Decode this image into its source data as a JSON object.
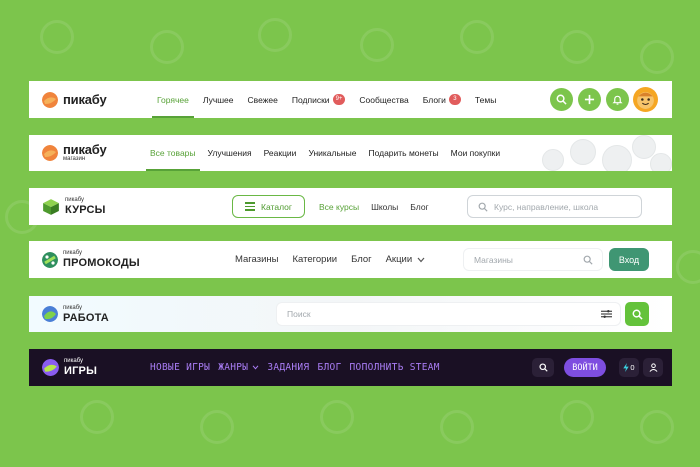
{
  "colors": {
    "background": "#7cc54c",
    "accent_green": "#58a238",
    "badge_red": "#e15c5c",
    "promo_button": "#3f9673",
    "games_bg": "#1a1024",
    "games_purple": "#a97df5"
  },
  "bar_main": {
    "logo": "пикабу",
    "nav": [
      {
        "label": "Горячее",
        "active": true
      },
      {
        "label": "Лучшее"
      },
      {
        "label": "Свежее"
      },
      {
        "label": "Подписки",
        "badge": "9+"
      },
      {
        "label": "Сообщества"
      },
      {
        "label": "Блоги",
        "badge": "3"
      },
      {
        "label": "Темы"
      }
    ],
    "icons": [
      "search-icon",
      "plus-icon",
      "bell-icon",
      "avatar"
    ]
  },
  "bar_shop": {
    "logo": "пикабу",
    "logo_sub": "магазин",
    "nav": [
      {
        "label": "Все товары",
        "active": true
      },
      {
        "label": "Улучшения"
      },
      {
        "label": "Реакции"
      },
      {
        "label": "Уникальные"
      },
      {
        "label": "Подарить монеты"
      },
      {
        "label": "Мои покупки"
      }
    ]
  },
  "bar_courses": {
    "logo_small": "пикабу",
    "logo_big": "КУРСЫ",
    "catalog_label": "Каталог",
    "nav": [
      {
        "label": "Все курсы",
        "active": true
      },
      {
        "label": "Школы"
      },
      {
        "label": "Блог"
      }
    ],
    "search_placeholder": "Курс, направление, школа"
  },
  "bar_promo": {
    "logo_small": "пикабу",
    "logo_big": "ПРОМОКОДЫ",
    "nav": [
      "Магазины",
      "Категории",
      "Блог",
      "Акции"
    ],
    "search_placeholder": "Магазины",
    "login_label": "Вход"
  },
  "bar_jobs": {
    "logo_small": "пикабу",
    "logo_big": "РАБОТА",
    "search_placeholder": "Поиск"
  },
  "bar_games": {
    "logo_small": "пикабу",
    "logo_big": "ИГРЫ",
    "nav": [
      "НОВЫЕ ИГРЫ",
      "ЖАНРЫ",
      "ЗАДАНИЯ",
      "БЛОГ",
      "ПОПОЛНИТЬ STEAM"
    ],
    "login_label": "ВОЙТИ",
    "counter": "0"
  }
}
